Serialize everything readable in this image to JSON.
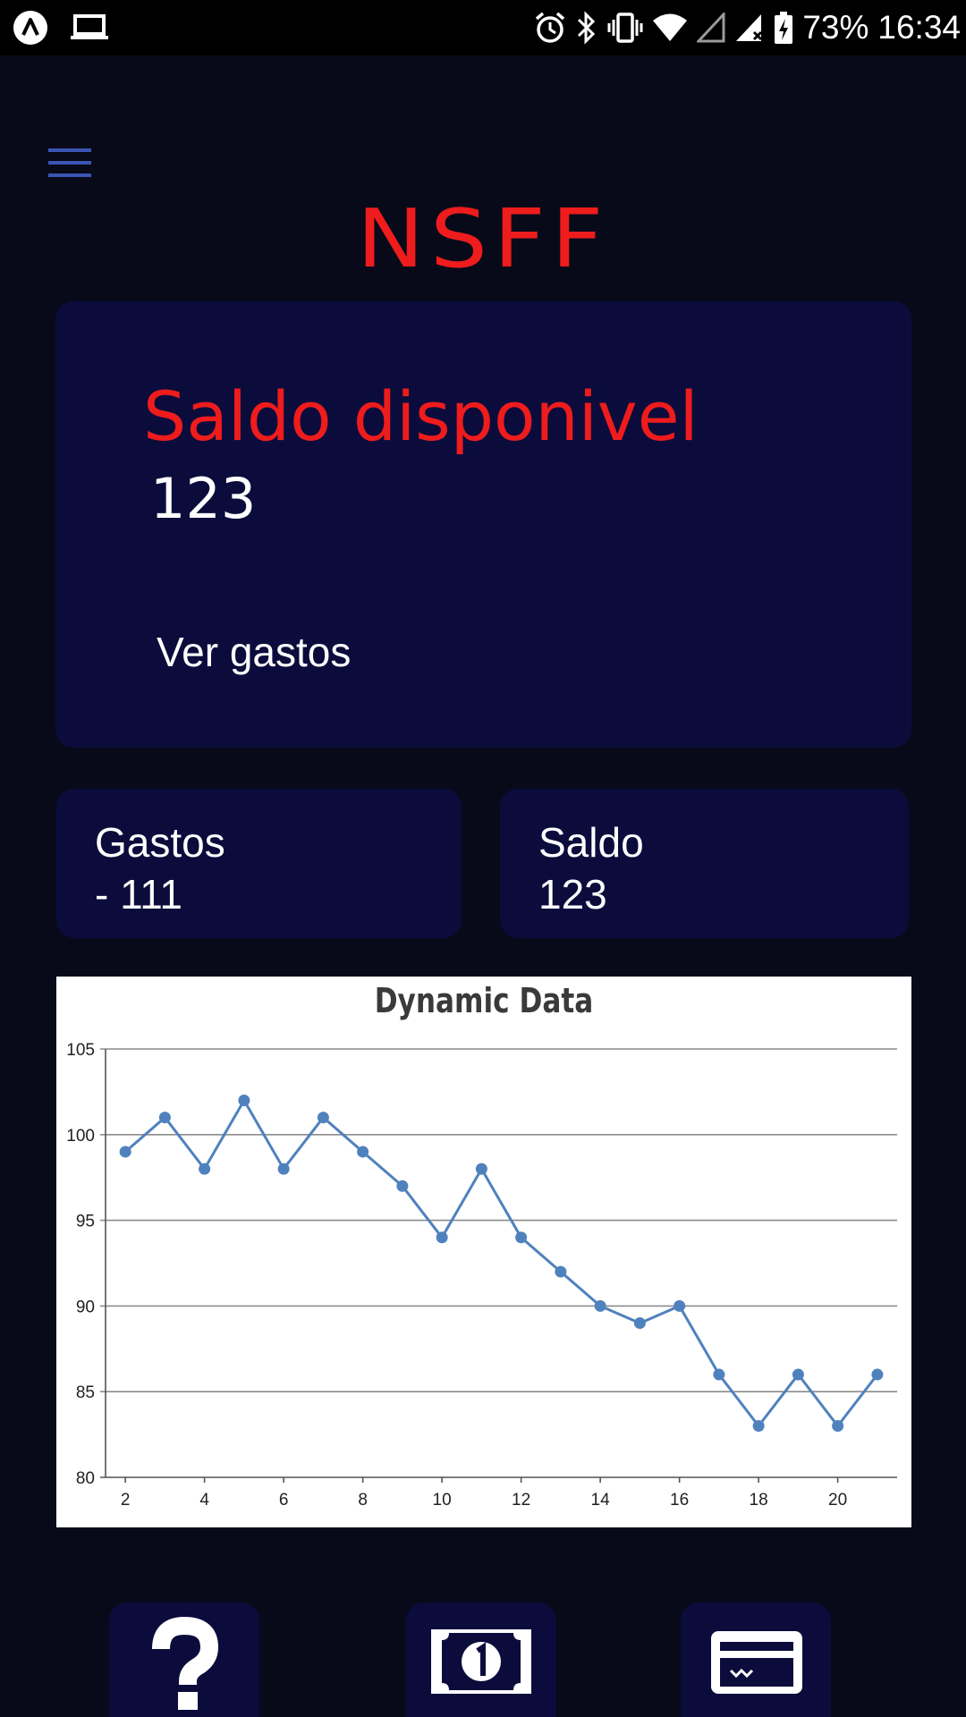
{
  "status_bar": {
    "battery": "73%",
    "time": "16:34"
  },
  "app": {
    "title": "NSFF"
  },
  "main_card": {
    "label": "Saldo disponivel",
    "value": "123",
    "link": "Ver gastos"
  },
  "gastos_card": {
    "title": "Gastos",
    "amount": "- 111"
  },
  "saldo_card": {
    "title": "Saldo",
    "amount": "123"
  },
  "colors": {
    "background": "#080a1a",
    "card": "#0b0c3c",
    "accent_red": "#ee1c1c",
    "menu_blue": "#3c54b4",
    "line_series": "#4f81bd"
  },
  "bottom_nav": {
    "icons": [
      "question-icon",
      "banknote-icon",
      "credit-card-icon"
    ]
  },
  "chart_data": {
    "type": "line",
    "title": "Dynamic Data",
    "x": [
      2,
      3,
      4,
      5,
      6,
      7,
      8,
      9,
      10,
      11,
      12,
      13,
      14,
      15,
      16,
      17,
      18,
      19,
      20,
      21
    ],
    "y": [
      99,
      101,
      98,
      102,
      98,
      101,
      99,
      97,
      94,
      98,
      94,
      92,
      90,
      89,
      90,
      86,
      83,
      86,
      83,
      86
    ],
    "xticks": [
      2,
      4,
      6,
      8,
      10,
      12,
      14,
      16,
      18,
      20
    ],
    "yticks": [
      80,
      85,
      90,
      95,
      100,
      105
    ],
    "xlim": [
      1.5,
      21.5
    ],
    "ylim": [
      80,
      105
    ],
    "grid": "horizontal",
    "legend": "none"
  }
}
